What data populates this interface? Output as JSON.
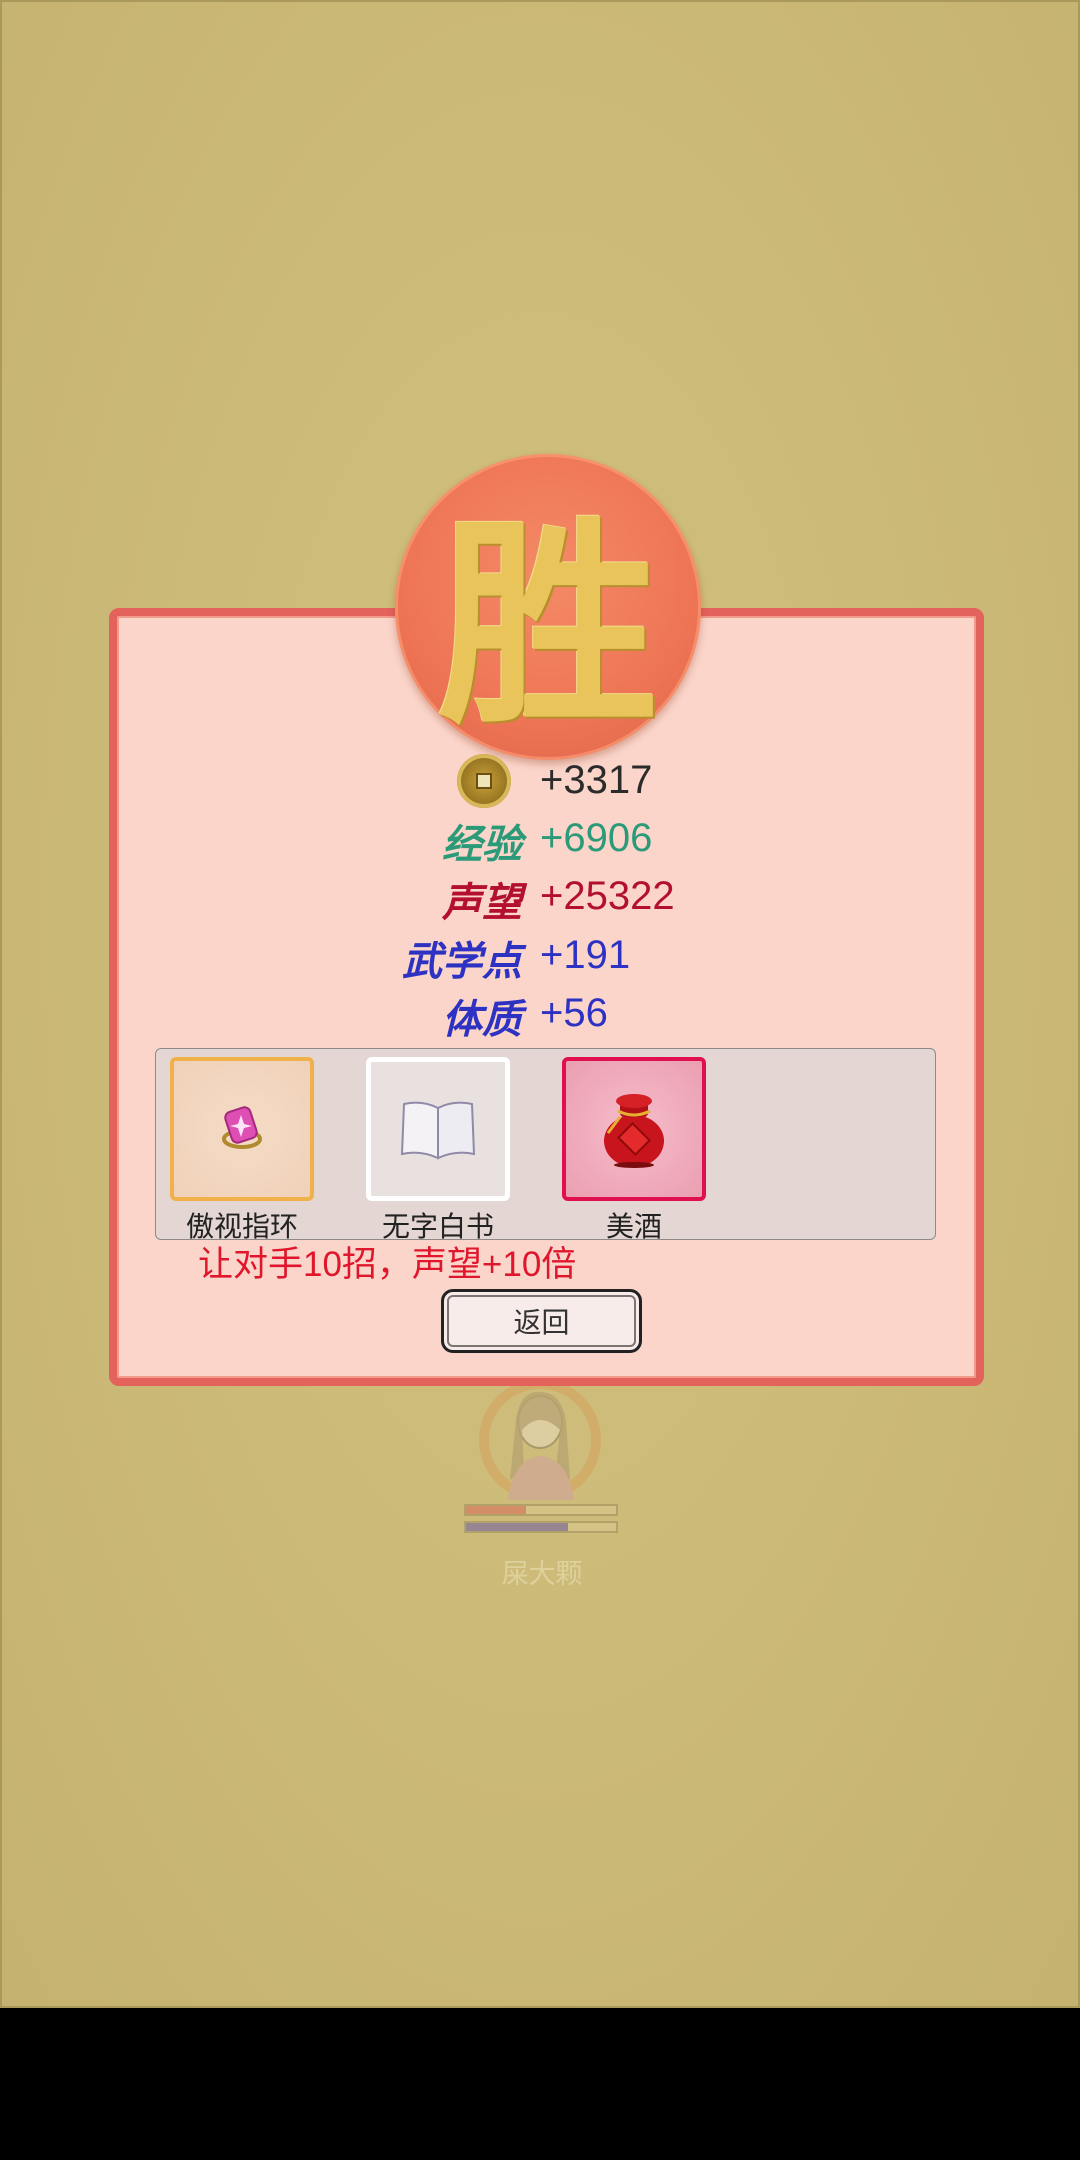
{
  "seal": {
    "text": "胜",
    "color": "#ee7555",
    "char_color": "#e9c45a"
  },
  "rewards": {
    "coins": {
      "icon": "coin-icon",
      "value": "+3317",
      "color": "#2b2b2b"
    },
    "exp": {
      "label": "经验",
      "value": "+6906",
      "color": "#2a9a78"
    },
    "reputation": {
      "label": "声望",
      "value": "+25322",
      "color": "#b3102e"
    },
    "martial_points": {
      "label": "武学点",
      "value": "+191",
      "color": "#2e32c2"
    },
    "constitution": {
      "label": "体质",
      "value": "+56",
      "color": "#2e32c2"
    }
  },
  "items": [
    {
      "name": "傲视指环",
      "icon": "ring-icon",
      "rarity_color": "#f1b14a"
    },
    {
      "name": "无字白书",
      "icon": "book-icon",
      "rarity_color": "#ffffff"
    },
    {
      "name": "美酒",
      "icon": "wine-jar-icon",
      "rarity_color": "#e0104e"
    }
  ],
  "hint": "让对手10招，声望+10倍",
  "back_button": "返回",
  "opponent": {
    "name": "屎大颗",
    "hp_fraction": 0.4,
    "mp_fraction": 0.68
  }
}
